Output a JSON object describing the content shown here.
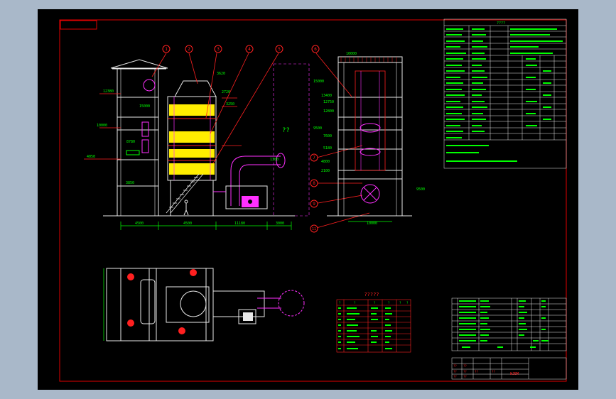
{
  "colors": {
    "background": "#a9b8c9",
    "sheet": "#000000",
    "frame": "#e00000",
    "structure": "#f0f0f0",
    "dimension": "#00ff00",
    "leader": "#ff2020",
    "fill_layer": "#ffee00",
    "duct": "#ff30ff",
    "annotation": "#00ffff",
    "stairs": "#ffffff"
  },
  "balloon_numbers": [
    "1",
    "2",
    "3",
    "4",
    "5",
    "6",
    "7",
    "8",
    "9",
    "10",
    "11"
  ],
  "center_marker": "??",
  "dimension_labels": {
    "left_levels": [
      "12380",
      "15000",
      "10000",
      "8780",
      "4050",
      "3850"
    ],
    "right_levels": [
      "15000",
      "13400",
      "12750",
      "12800",
      "9500",
      "7600",
      "5180",
      "4800",
      "2100",
      "9500"
    ],
    "bottom_left": [
      "4500",
      "4500",
      "11180",
      "3000"
    ],
    "bottom_right": "10000",
    "top_right": "10000",
    "small_notes": [
      "3620",
      "2720",
      "3250",
      "1300"
    ]
  },
  "parts_table": {
    "title": "?????",
    "header": [
      "?",
      "?",
      "?",
      "?",
      "?",
      "?"
    ]
  },
  "notes": {
    "title_row": "????",
    "footer_left": "????",
    "footer_right": "????"
  },
  "title_block": {
    "cells": [
      "??",
      "??",
      "??",
      "??",
      "??",
      "??",
      "??",
      "??"
    ],
    "stamp": "WJBM"
  }
}
